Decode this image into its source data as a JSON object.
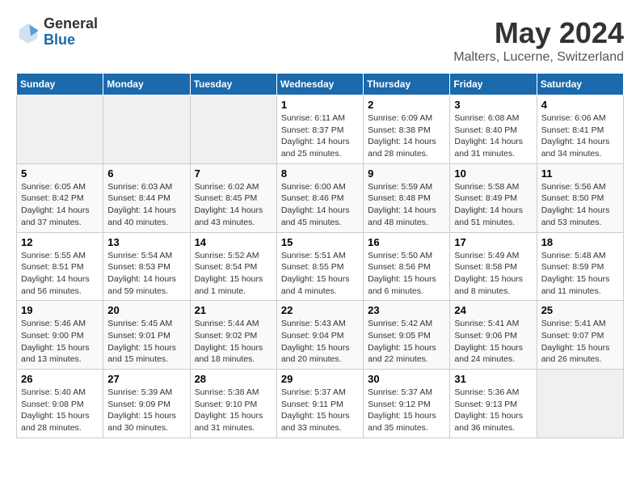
{
  "header": {
    "logo_general": "General",
    "logo_blue": "Blue",
    "title": "May 2024",
    "subtitle": "Malters, Lucerne, Switzerland"
  },
  "days_of_week": [
    "Sunday",
    "Monday",
    "Tuesday",
    "Wednesday",
    "Thursday",
    "Friday",
    "Saturday"
  ],
  "weeks": [
    [
      {
        "day": "",
        "info": ""
      },
      {
        "day": "",
        "info": ""
      },
      {
        "day": "",
        "info": ""
      },
      {
        "day": "1",
        "info": "Sunrise: 6:11 AM\nSunset: 8:37 PM\nDaylight: 14 hours\nand 25 minutes."
      },
      {
        "day": "2",
        "info": "Sunrise: 6:09 AM\nSunset: 8:38 PM\nDaylight: 14 hours\nand 28 minutes."
      },
      {
        "day": "3",
        "info": "Sunrise: 6:08 AM\nSunset: 8:40 PM\nDaylight: 14 hours\nand 31 minutes."
      },
      {
        "day": "4",
        "info": "Sunrise: 6:06 AM\nSunset: 8:41 PM\nDaylight: 14 hours\nand 34 minutes."
      }
    ],
    [
      {
        "day": "5",
        "info": "Sunrise: 6:05 AM\nSunset: 8:42 PM\nDaylight: 14 hours\nand 37 minutes."
      },
      {
        "day": "6",
        "info": "Sunrise: 6:03 AM\nSunset: 8:44 PM\nDaylight: 14 hours\nand 40 minutes."
      },
      {
        "day": "7",
        "info": "Sunrise: 6:02 AM\nSunset: 8:45 PM\nDaylight: 14 hours\nand 43 minutes."
      },
      {
        "day": "8",
        "info": "Sunrise: 6:00 AM\nSunset: 8:46 PM\nDaylight: 14 hours\nand 45 minutes."
      },
      {
        "day": "9",
        "info": "Sunrise: 5:59 AM\nSunset: 8:48 PM\nDaylight: 14 hours\nand 48 minutes."
      },
      {
        "day": "10",
        "info": "Sunrise: 5:58 AM\nSunset: 8:49 PM\nDaylight: 14 hours\nand 51 minutes."
      },
      {
        "day": "11",
        "info": "Sunrise: 5:56 AM\nSunset: 8:50 PM\nDaylight: 14 hours\nand 53 minutes."
      }
    ],
    [
      {
        "day": "12",
        "info": "Sunrise: 5:55 AM\nSunset: 8:51 PM\nDaylight: 14 hours\nand 56 minutes."
      },
      {
        "day": "13",
        "info": "Sunrise: 5:54 AM\nSunset: 8:53 PM\nDaylight: 14 hours\nand 59 minutes."
      },
      {
        "day": "14",
        "info": "Sunrise: 5:52 AM\nSunset: 8:54 PM\nDaylight: 15 hours\nand 1 minute."
      },
      {
        "day": "15",
        "info": "Sunrise: 5:51 AM\nSunset: 8:55 PM\nDaylight: 15 hours\nand 4 minutes."
      },
      {
        "day": "16",
        "info": "Sunrise: 5:50 AM\nSunset: 8:56 PM\nDaylight: 15 hours\nand 6 minutes."
      },
      {
        "day": "17",
        "info": "Sunrise: 5:49 AM\nSunset: 8:58 PM\nDaylight: 15 hours\nand 8 minutes."
      },
      {
        "day": "18",
        "info": "Sunrise: 5:48 AM\nSunset: 8:59 PM\nDaylight: 15 hours\nand 11 minutes."
      }
    ],
    [
      {
        "day": "19",
        "info": "Sunrise: 5:46 AM\nSunset: 9:00 PM\nDaylight: 15 hours\nand 13 minutes."
      },
      {
        "day": "20",
        "info": "Sunrise: 5:45 AM\nSunset: 9:01 PM\nDaylight: 15 hours\nand 15 minutes."
      },
      {
        "day": "21",
        "info": "Sunrise: 5:44 AM\nSunset: 9:02 PM\nDaylight: 15 hours\nand 18 minutes."
      },
      {
        "day": "22",
        "info": "Sunrise: 5:43 AM\nSunset: 9:04 PM\nDaylight: 15 hours\nand 20 minutes."
      },
      {
        "day": "23",
        "info": "Sunrise: 5:42 AM\nSunset: 9:05 PM\nDaylight: 15 hours\nand 22 minutes."
      },
      {
        "day": "24",
        "info": "Sunrise: 5:41 AM\nSunset: 9:06 PM\nDaylight: 15 hours\nand 24 minutes."
      },
      {
        "day": "25",
        "info": "Sunrise: 5:41 AM\nSunset: 9:07 PM\nDaylight: 15 hours\nand 26 minutes."
      }
    ],
    [
      {
        "day": "26",
        "info": "Sunrise: 5:40 AM\nSunset: 9:08 PM\nDaylight: 15 hours\nand 28 minutes."
      },
      {
        "day": "27",
        "info": "Sunrise: 5:39 AM\nSunset: 9:09 PM\nDaylight: 15 hours\nand 30 minutes."
      },
      {
        "day": "28",
        "info": "Sunrise: 5:38 AM\nSunset: 9:10 PM\nDaylight: 15 hours\nand 31 minutes."
      },
      {
        "day": "29",
        "info": "Sunrise: 5:37 AM\nSunset: 9:11 PM\nDaylight: 15 hours\nand 33 minutes."
      },
      {
        "day": "30",
        "info": "Sunrise: 5:37 AM\nSunset: 9:12 PM\nDaylight: 15 hours\nand 35 minutes."
      },
      {
        "day": "31",
        "info": "Sunrise: 5:36 AM\nSunset: 9:13 PM\nDaylight: 15 hours\nand 36 minutes."
      },
      {
        "day": "",
        "info": ""
      }
    ]
  ]
}
